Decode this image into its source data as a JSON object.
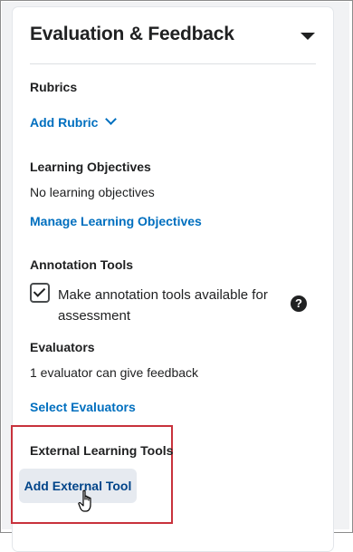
{
  "panel": {
    "title": "Evaluation & Feedback"
  },
  "rubrics": {
    "label": "Rubrics",
    "add_link": "Add Rubric"
  },
  "objectives": {
    "label": "Learning Objectives",
    "status": "No learning objectives",
    "manage_link": "Manage Learning Objectives"
  },
  "annotation": {
    "label": "Annotation Tools",
    "checkbox_label": "Make annotation tools available for assessment",
    "checked": true,
    "help_icon": "?"
  },
  "evaluators": {
    "label": "Evaluators",
    "status": "1 evaluator can give feedback",
    "select_link": "Select Evaluators"
  },
  "external_tools": {
    "label": "External Learning Tools",
    "add_button": "Add External Tool"
  },
  "colors": {
    "link": "#006fbf",
    "highlight": "#c8323c",
    "button_bg": "#e6eaf0"
  }
}
